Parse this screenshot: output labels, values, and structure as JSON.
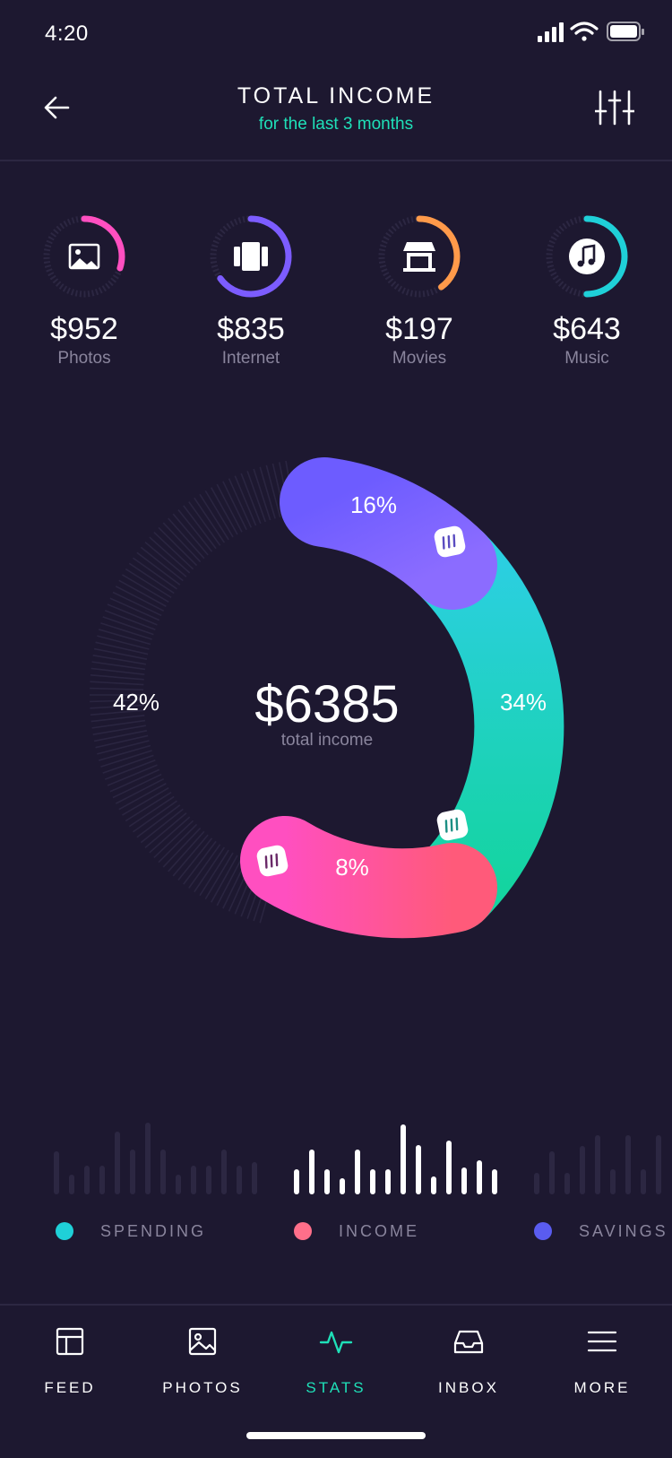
{
  "status_bar": {
    "time": "4:20"
  },
  "header": {
    "title": "TOTAL INCOME",
    "subtitle": "for the last 3 months",
    "back_icon": "arrow-left-icon",
    "filter_icon": "sliders-icon"
  },
  "categories": [
    {
      "amount": "$952",
      "label": "Photos",
      "icon": "image-icon",
      "color": "#ff4fc0",
      "progress": 0.3
    },
    {
      "amount": "$835",
      "label": "Internet",
      "icon": "film-icon",
      "color": "#7c5cff",
      "progress": 0.65
    },
    {
      "amount": "$197",
      "label": "Movies",
      "icon": "store-icon",
      "color": "#ff9a4a",
      "progress": 0.4
    },
    {
      "amount": "$643",
      "label": "Music",
      "icon": "music-icon",
      "color": "#1fd0d8",
      "progress": 0.5
    }
  ],
  "chart_data": {
    "type": "pie",
    "center_value": "$6385",
    "center_label": "total income",
    "slices": [
      {
        "label": "16%",
        "value": 16,
        "colors": [
          "#6d5cff",
          "#8b6cff"
        ]
      },
      {
        "label": "34%",
        "value": 34,
        "colors": [
          "#2bcfe0",
          "#14d4a0"
        ]
      },
      {
        "label": "8%",
        "value": 8,
        "colors": [
          "#ff4fc0",
          "#ff5a7a"
        ]
      },
      {
        "label": "42%",
        "value": 42,
        "colors": [
          "#2c2742",
          "#2c2742"
        ]
      }
    ]
  },
  "bar_groups": [
    {
      "name": "spending",
      "values": [
        48,
        22,
        32,
        32,
        70,
        50,
        80,
        50,
        22,
        32,
        32,
        50,
        32,
        36
      ],
      "color": "#2c2742"
    },
    {
      "name": "income",
      "values": [
        28,
        50,
        28,
        18,
        50,
        28,
        28,
        78,
        55,
        20,
        60,
        30,
        38,
        28
      ],
      "color": "#ffffff"
    },
    {
      "name": "savings",
      "values": [
        24,
        48,
        24,
        54,
        66,
        28,
        66,
        28,
        66,
        46
      ],
      "color": "#2c2742"
    }
  ],
  "legend": [
    {
      "label": "SPENDING",
      "color": "#1fd0d8"
    },
    {
      "label": "INCOME",
      "color": "#ff6f8a"
    },
    {
      "label": "SAVINGS",
      "color": "#5a5cf0"
    }
  ],
  "nav": {
    "items": [
      {
        "label": "FEED",
        "icon": "layout-icon",
        "active": false
      },
      {
        "label": "PHOTOS",
        "icon": "image-icon",
        "active": false
      },
      {
        "label": "STATS",
        "icon": "activity-icon",
        "active": true
      },
      {
        "label": "INBOX",
        "icon": "inbox-icon",
        "active": false
      },
      {
        "label": "MORE",
        "icon": "menu-icon",
        "active": false
      }
    ],
    "active_color": "#1fe0b8"
  }
}
